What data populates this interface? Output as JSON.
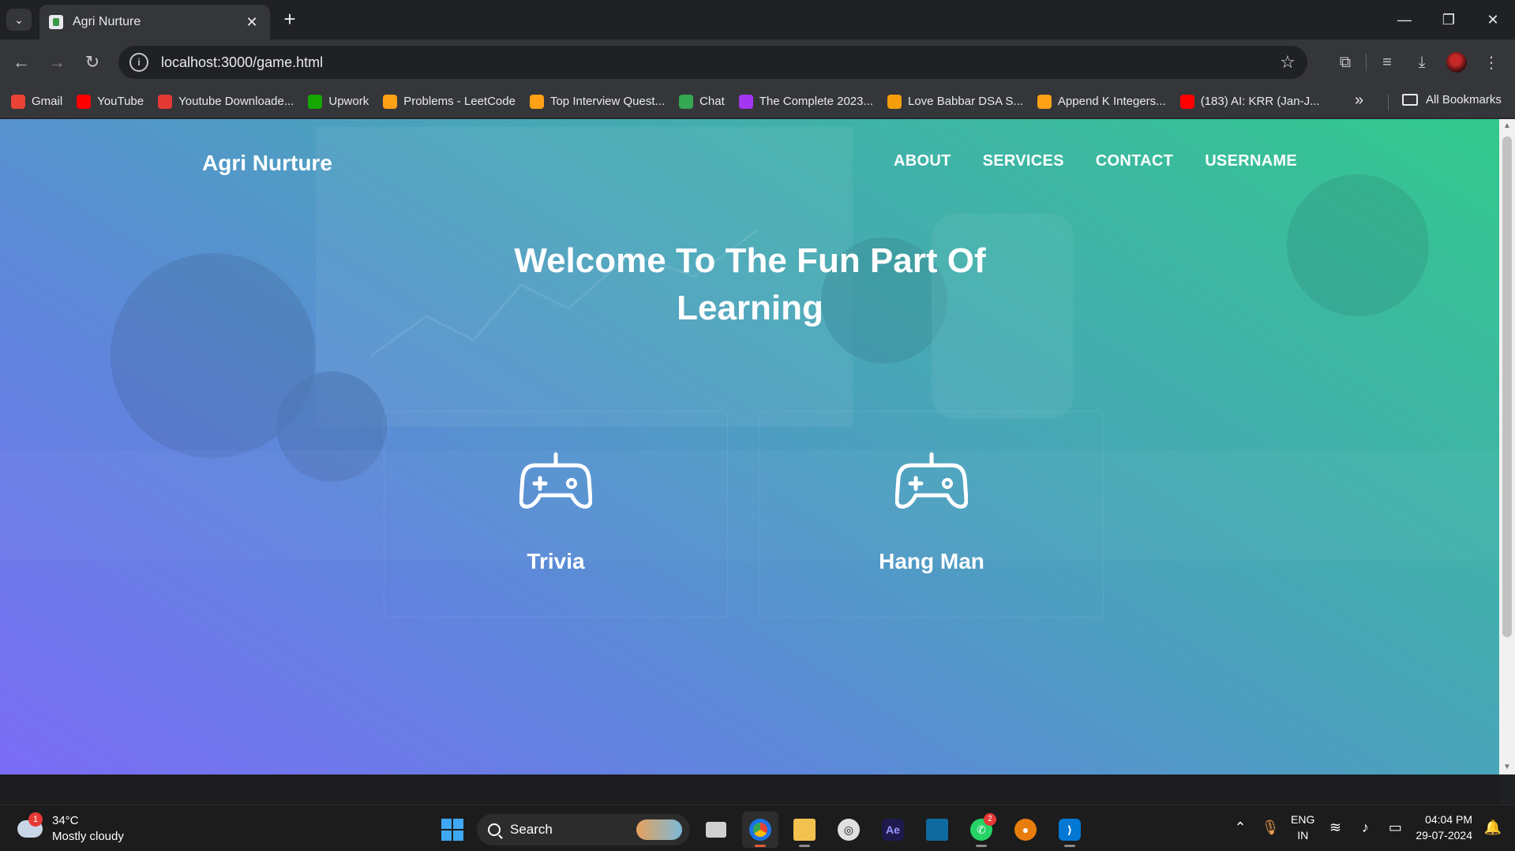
{
  "browser": {
    "tab_title": "Agri Nurture",
    "url": "localhost:3000/game.html",
    "bookmarks": [
      {
        "label": "Gmail",
        "icon": "gmail-icon",
        "color": "#ea4335"
      },
      {
        "label": "YouTube",
        "icon": "youtube-icon",
        "color": "#ff0000"
      },
      {
        "label": "Youtube Downloade...",
        "icon": "download-icon",
        "color": "#e53935"
      },
      {
        "label": "Upwork",
        "icon": "upwork-icon",
        "color": "#14a800"
      },
      {
        "label": "Problems - LeetCode",
        "icon": "leetcode-icon",
        "color": "#ffa116"
      },
      {
        "label": "Top Interview Quest...",
        "icon": "leetcode-icon",
        "color": "#ffa116"
      },
      {
        "label": "Chat",
        "icon": "chat-icon",
        "color": "#34a853"
      },
      {
        "label": "The Complete 2023...",
        "icon": "udemy-icon",
        "color": "#a435f0"
      },
      {
        "label": "Love Babbar DSA S...",
        "icon": "sheet-icon",
        "color": "#f59e0b"
      },
      {
        "label": "Append K Integers...",
        "icon": "leetcode-icon",
        "color": "#ffa116"
      },
      {
        "label": "(183) AI: KRR (Jan-J...",
        "icon": "youtube-icon",
        "color": "#ff0000"
      }
    ],
    "all_bookmarks": "All Bookmarks"
  },
  "site": {
    "brand": "Agri Nurture",
    "nav": [
      "ABOUT",
      "SERVICES",
      "CONTACT",
      "USERNAME"
    ],
    "headline_line1": "Welcome To The Fun Part Of",
    "headline_line2": "Learning",
    "cards": [
      {
        "title": "Trivia",
        "icon": "gamepad-icon"
      },
      {
        "title": "Hang Man",
        "icon": "gamepad-icon"
      }
    ],
    "gradient_colors": [
      "#7b6cf6",
      "#48a6b8",
      "#32c98c"
    ]
  },
  "taskbar": {
    "badge": "1",
    "temp": "34°C",
    "weather": "Mostly cloudy",
    "search": "Search",
    "whatsapp_badge": "2",
    "lang1": "ENG",
    "lang2": "IN",
    "time": "04:04 PM",
    "date": "29-07-2024"
  }
}
